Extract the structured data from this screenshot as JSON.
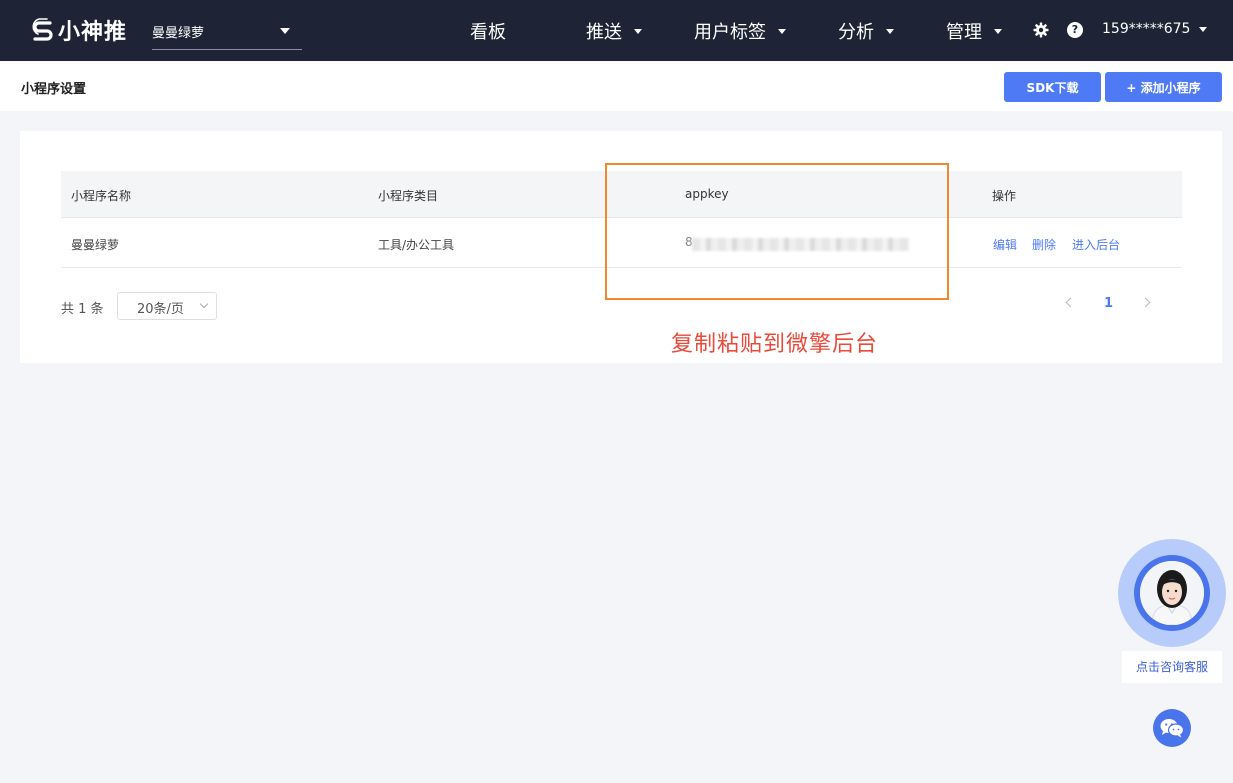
{
  "nav": {
    "logo_text": "小神推",
    "app_select": "曼曼绿萝",
    "items": [
      "看板",
      "推送",
      "用户标签",
      "分析",
      "管理"
    ],
    "user": "159*****675"
  },
  "subheader": {
    "title": "小程序设置",
    "sdk_button": "SDK下载",
    "add_button": "+ 添加小程序"
  },
  "table": {
    "columns": [
      "小程序名称",
      "小程序类目",
      "appkey",
      "操作"
    ],
    "rows": [
      {
        "name": "曼曼绿萝",
        "category": "工具/办公工具",
        "appkey_prefix": "8",
        "actions": [
          "编辑",
          "删除",
          "进入后台"
        ]
      }
    ]
  },
  "pagination": {
    "total": "共 1 条",
    "page_size": "20条/页",
    "current_page": "1"
  },
  "annotation": "复制粘贴到微擎后台",
  "customer_service": "点击咨询客服",
  "colors": {
    "nav_bg": "#1e2435",
    "accent": "#4f7af6",
    "annotation": "#f0882e",
    "annotation_text": "#e84a3b"
  }
}
